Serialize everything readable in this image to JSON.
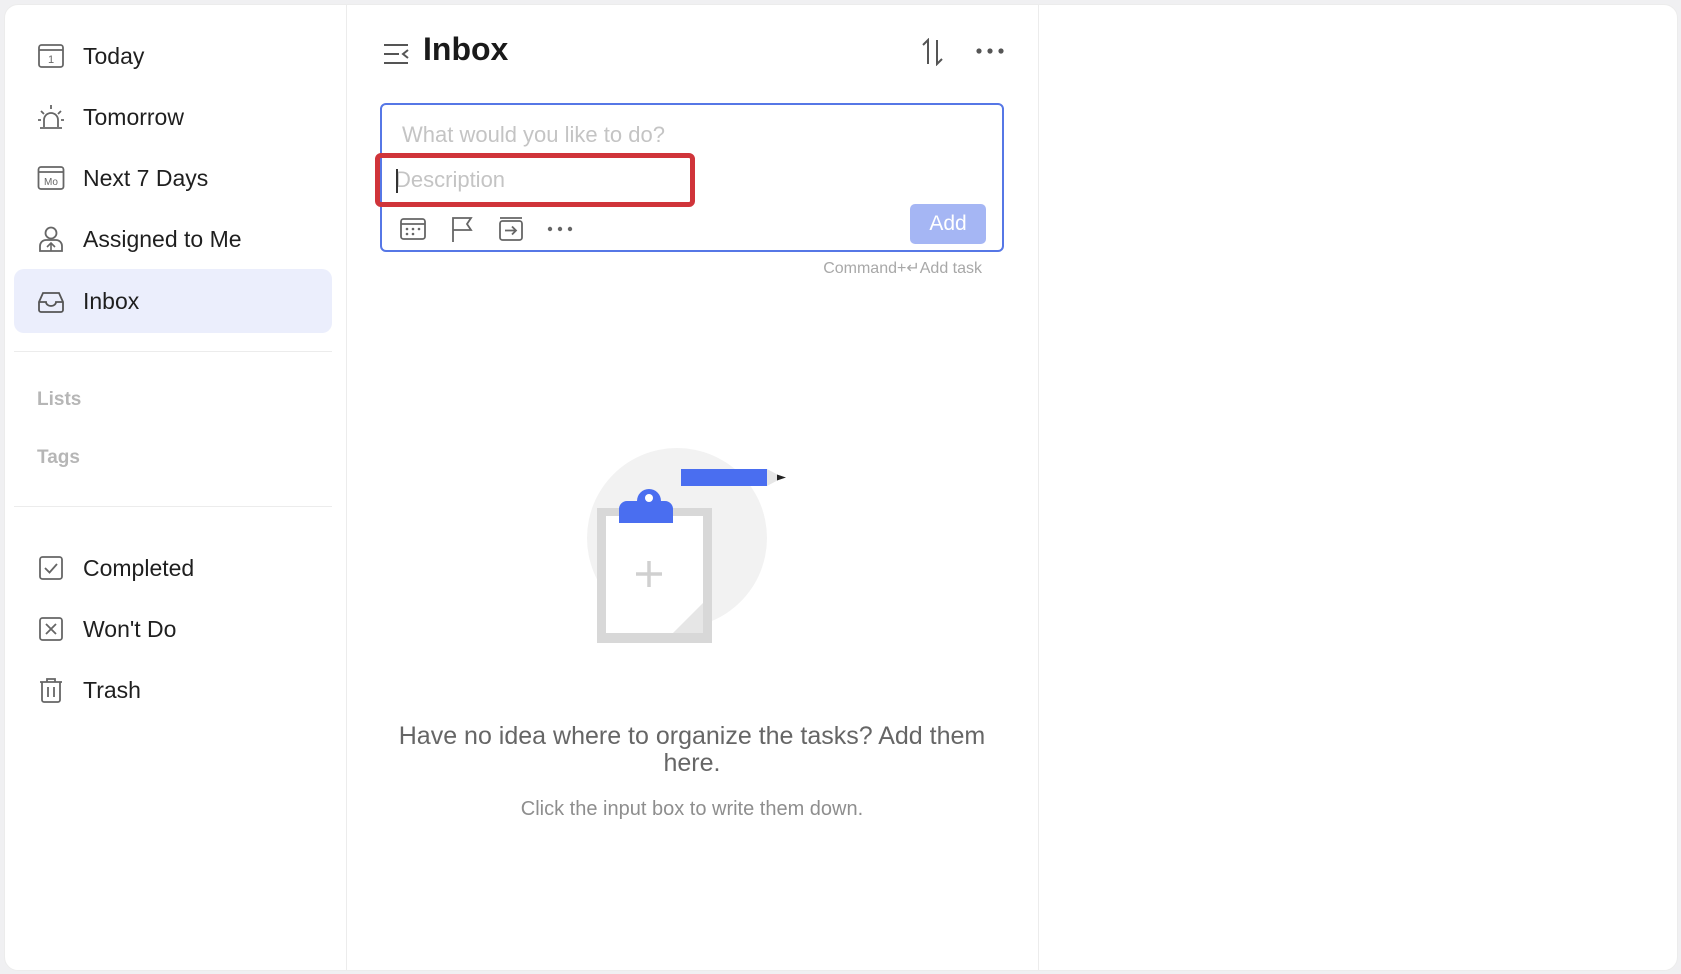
{
  "sidebar": {
    "nav": [
      {
        "label": "Today",
        "icon": "calendar-today-icon"
      },
      {
        "label": "Tomorrow",
        "icon": "sunrise-icon"
      },
      {
        "label": "Next 7 Days",
        "icon": "calendar-week-icon"
      },
      {
        "label": "Assigned to Me",
        "icon": "person-icon"
      },
      {
        "label": "Inbox",
        "icon": "inbox-icon",
        "active": true
      }
    ],
    "today_day_number": "1",
    "week_icon_text": "Mo",
    "sections": {
      "lists": "Lists",
      "tags": "Tags"
    },
    "bottom": [
      {
        "label": "Completed",
        "icon": "checkbox-icon"
      },
      {
        "label": "Won't Do",
        "icon": "x-box-icon"
      },
      {
        "label": "Trash",
        "icon": "trash-icon"
      }
    ]
  },
  "main": {
    "title": "Inbox",
    "task_input": {
      "title_placeholder": "What would you like to do?",
      "description_placeholder": "Description",
      "add_label": "Add",
      "hint": "Command+↵Add task"
    },
    "empty_state": {
      "title": "Have no idea where to organize the tasks? Add them here.",
      "subtitle": "Click the input box to write them down."
    }
  },
  "colors": {
    "accent": "#5677e6",
    "active_bg": "#ebeefc",
    "add_button": "#a5b6f4",
    "highlight_box": "#d0343a"
  }
}
